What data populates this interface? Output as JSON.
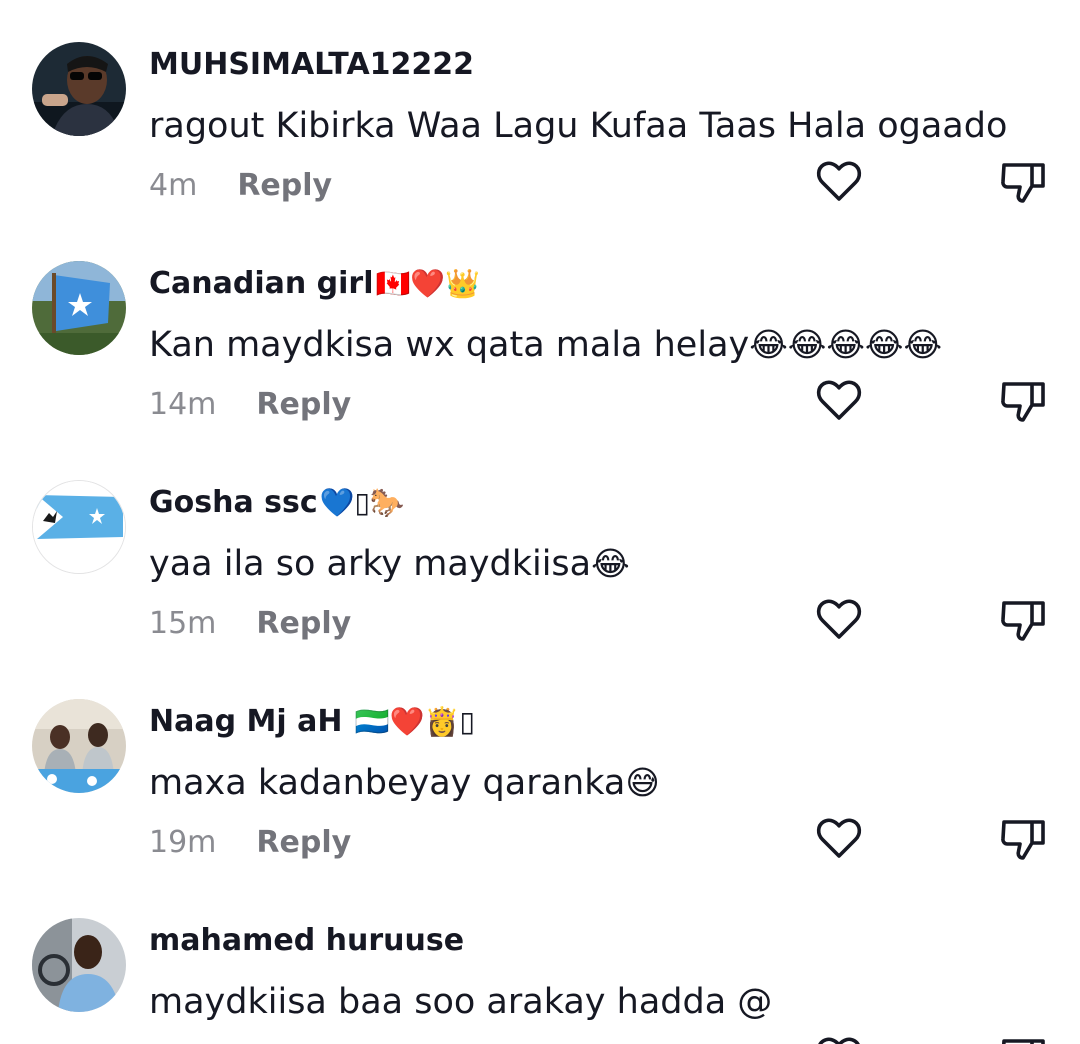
{
  "comments": [
    {
      "username": "MUHSIMALTA12222",
      "username_emoji": "",
      "text": "ragout Kibirka Waa Lagu Kufaa Taas Hala ogaado",
      "text_emoji": "",
      "time": "4m",
      "reply_label": "Reply",
      "avatar_icon": "profile-photo-man-sunglasses"
    },
    {
      "username": "Canadian girl",
      "username_emoji": "🇨🇦❤️👑",
      "text": "Kan maydkisa wx qata mala helay",
      "text_emoji": "😂😂😂😂😂",
      "time": "14m",
      "reply_label": "Reply",
      "avatar_icon": "somali-flag-photo"
    },
    {
      "username": "Gosha ssc",
      "username_emoji": "💙▯🐎",
      "text": "yaa ila so arky maydkiisa",
      "text_emoji": "😂",
      "time": "15m",
      "reply_label": "Reply",
      "avatar_icon": "flag-star-horseman"
    },
    {
      "username": "Naag Mj aH ",
      "username_emoji": "🇸🇱❤️👸▯",
      "text": "maxa kadanbeyay qaranka",
      "text_emoji": "😅",
      "time": "19m",
      "reply_label": "Reply",
      "avatar_icon": "profile-photo-group"
    },
    {
      "username": "mahamed huruuse",
      "username_emoji": "",
      "text": "maydkiisa baa soo arakay hadda @",
      "text_emoji": "",
      "time": "",
      "reply_label": "",
      "avatar_icon": "profile-photo-man-car"
    }
  ],
  "icons": {
    "like": "heart-outline-icon",
    "dislike": "thumbs-down-outline-icon"
  },
  "colors": {
    "primary_text": "#161823",
    "secondary_text": "#8a8b91",
    "icon": "#161823"
  }
}
